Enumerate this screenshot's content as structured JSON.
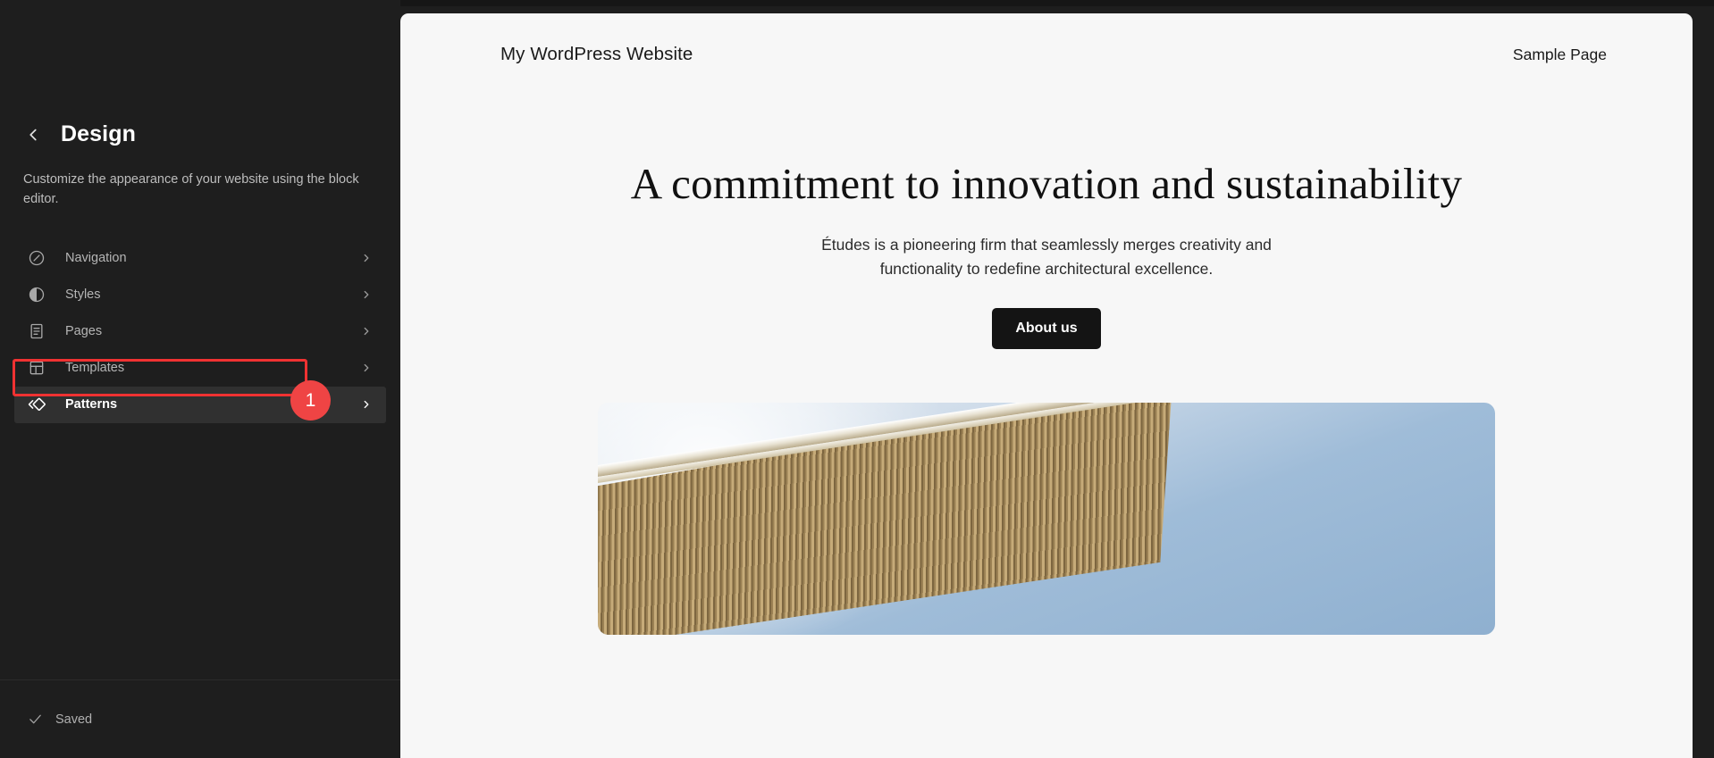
{
  "sidebar": {
    "back_icon": "chevron-left-icon",
    "title": "Design",
    "description": "Customize the appearance of your website using the block editor.",
    "items": [
      {
        "label": "Navigation",
        "icon": "compass-icon"
      },
      {
        "label": "Styles",
        "icon": "contrast-half-circle-icon"
      },
      {
        "label": "Pages",
        "icon": "document-lines-icon"
      },
      {
        "label": "Templates",
        "icon": "layout-grid-icon"
      },
      {
        "label": "Patterns",
        "icon": "patterns-diamond-icon"
      }
    ],
    "footer": {
      "saved_label": "Saved",
      "saved_icon": "check-icon"
    }
  },
  "annotation": {
    "badge_number": "1",
    "highlight_color": "#f03232",
    "badge_color": "#ef4444",
    "target": "Patterns"
  },
  "canvas": {
    "site_title": "My WordPress Website",
    "nav_links": [
      {
        "label": "Sample Page"
      }
    ],
    "hero": {
      "heading": "A commitment to innovation and sustainability",
      "subtext": "Études is a pioneering firm that seamlessly merges creativity and functionality to redefine architectural excellence.",
      "button_label": "About us",
      "image_alt": "architectural-building-roof-photo"
    }
  },
  "theme": {
    "sidebar_bg": "#1e1e1e",
    "canvas_bg": "#f7f7f7",
    "accent_dark": "#141414"
  }
}
